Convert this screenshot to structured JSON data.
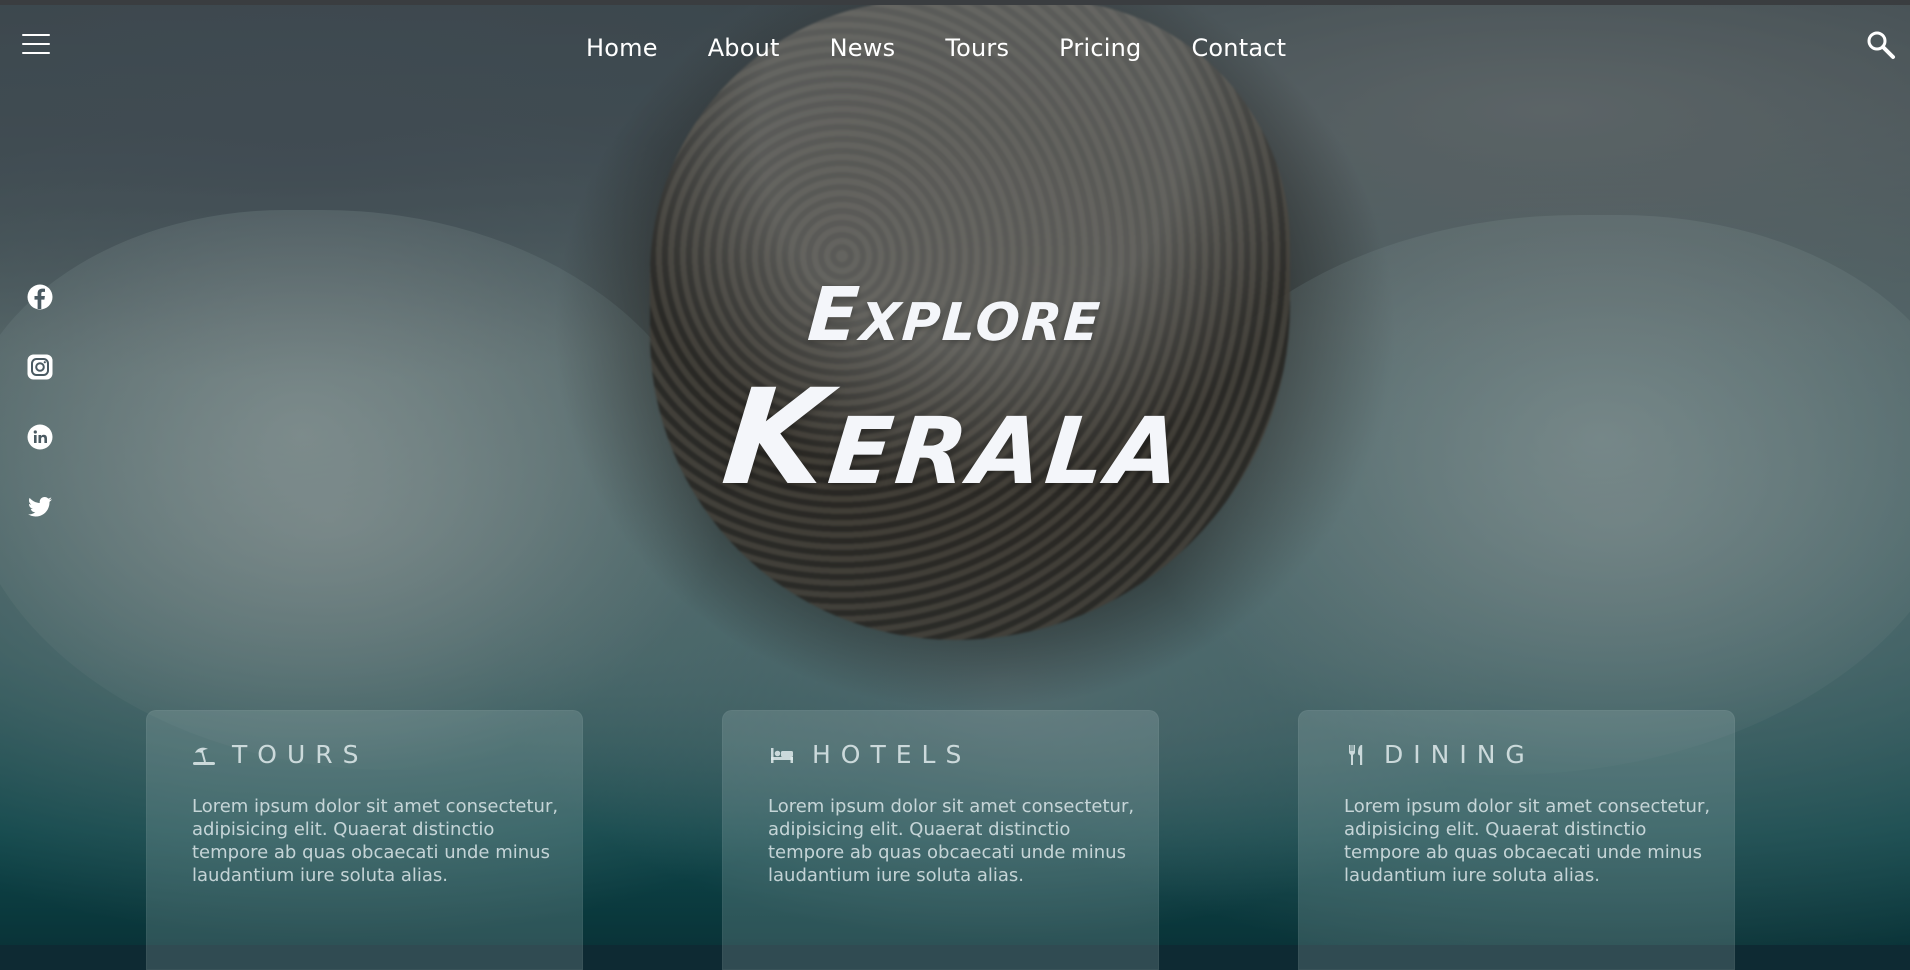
{
  "header": {
    "menu_icon": "hamburger-menu-icon",
    "nav": [
      {
        "label": "Home"
      },
      {
        "label": "About"
      },
      {
        "label": "News"
      },
      {
        "label": "Tours"
      },
      {
        "label": "Pricing"
      },
      {
        "label": "Contact"
      }
    ],
    "search_icon": "search-icon"
  },
  "social": [
    "facebook-icon",
    "instagram-icon",
    "linkedin-icon",
    "twitter-icon"
  ],
  "hero": {
    "subtitle": "Explore",
    "title": "Kerala"
  },
  "cards": [
    {
      "icon": "beach-umbrella-icon",
      "title": "TOURS",
      "text": "Lorem ipsum dolor sit amet consectetur, adipisicing elit. Quaerat distinctio tempore ab quas obcaecati unde minus laudantium iure soluta alias."
    },
    {
      "icon": "bed-icon",
      "title": "HOTELS",
      "text": "Lorem ipsum dolor sit amet consectetur, adipisicing elit. Quaerat distinctio tempore ab quas obcaecati unde minus laudantium iure soluta alias."
    },
    {
      "icon": "fork-knife-icon",
      "title": "DINING",
      "text": "Lorem ipsum dolor sit amet consectetur, adipisicing elit. Quaerat distinctio tempore ab quas obcaecati unde minus laudantium iure soluta alias."
    }
  ],
  "colors": {
    "text": "#f4f6fa",
    "card_bg": "rgba(175,195,198,0.22)"
  }
}
